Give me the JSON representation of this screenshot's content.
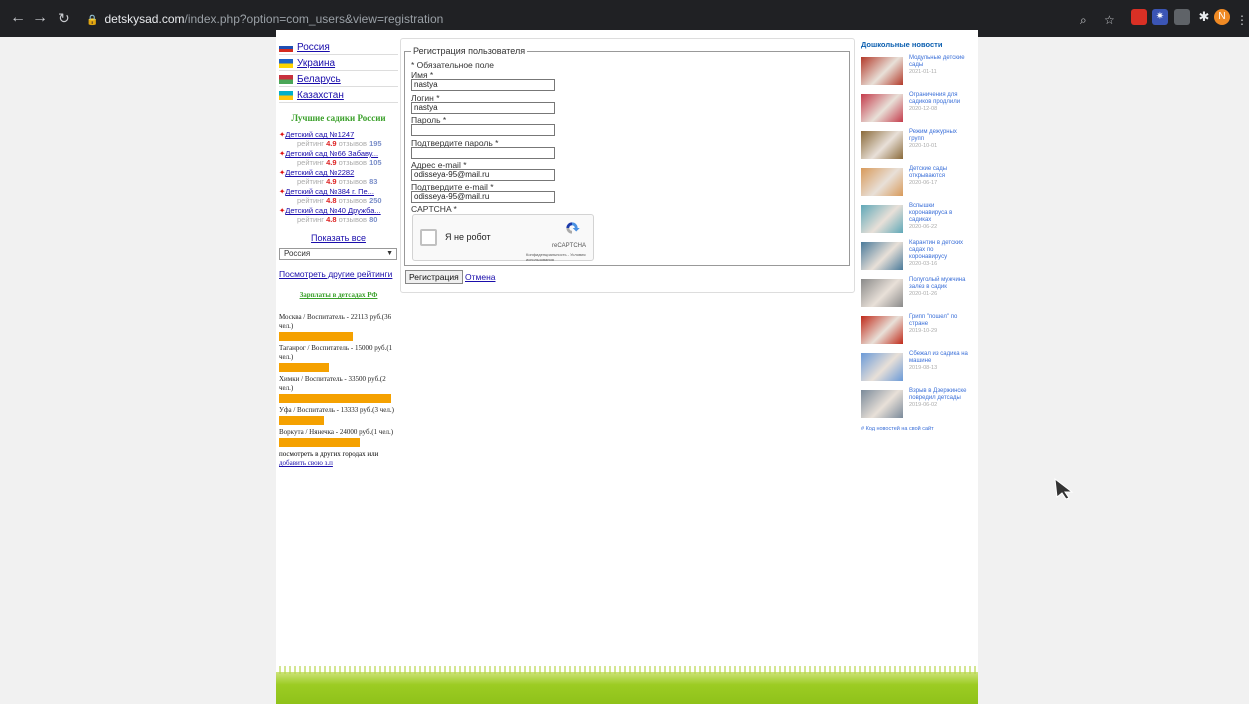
{
  "browser": {
    "url_host": "detskysad.com",
    "url_path": "/index.php?option=com_users&view=registration",
    "profile_initial": "N"
  },
  "left": {
    "countries": [
      {
        "label": "Россия",
        "colors": [
          "#ffffff",
          "#1f4fb4",
          "#d52b1e"
        ]
      },
      {
        "label": "Украина",
        "colors": [
          "#1f64c8",
          "#ffd500"
        ]
      },
      {
        "label": "Беларусь",
        "colors": [
          "#c8313e",
          "#4aa657"
        ]
      },
      {
        "label": "Казахстан",
        "colors": [
          "#00afca",
          "#fec50c"
        ]
      }
    ],
    "best_title": "Лучшие садики России",
    "kindergartens": [
      {
        "name": "Детский сад №1247",
        "rating_label": "рейтинг",
        "rating": "4.9",
        "reviews_label": "отзывов",
        "reviews": "195"
      },
      {
        "name": "Детский сад №66 Забаву...",
        "rating_label": "рейтинг",
        "rating": "4.9",
        "reviews_label": "отзывов",
        "reviews": "105"
      },
      {
        "name": "Детский сад №2282",
        "rating_label": "рейтинг",
        "rating": "4.9",
        "reviews_label": "отзывов",
        "reviews": "83"
      },
      {
        "name": "Детский сад №384 г. Пе...",
        "rating_label": "рейтинг",
        "rating": "4.8",
        "reviews_label": "отзывов",
        "reviews": "250"
      },
      {
        "name": "Детский сад №40 Дружба...",
        "rating_label": "рейтинг",
        "rating": "4.8",
        "reviews_label": "отзывов",
        "reviews": "80"
      }
    ],
    "show_all": "Показать все",
    "region_select": "Россия",
    "other_ratings": "Посмотреть другие рейтинги",
    "salary_title": "Зарплаты в детсадах РФ",
    "salaries": [
      {
        "text": "Москва / Воспитатель - 22113 руб.(36 чел.)",
        "fraction": 0.66
      },
      {
        "text": "Таганрог / Воспитатель - 15000 руб.(1 чел.)",
        "fraction": 0.45
      },
      {
        "text": "Химки / Воспитатель - 33500 руб.(2 чел.)",
        "fraction": 1.0
      },
      {
        "text": "Уфа / Воспитатель - 13333 руб.(3 чел.)",
        "fraction": 0.4
      },
      {
        "text": "Воркута / Нянечка - 24000 руб.(1 чел.)",
        "fraction": 0.72
      }
    ],
    "other_cities_text": "посмотреть в других городах или",
    "add_salary_link": "добавить свою з.п"
  },
  "form": {
    "legend": "Регистрация пользователя",
    "required_note": "* Обязательное поле",
    "fields": {
      "name_label": "Имя *",
      "name_value": "nastya",
      "login_label": "Логин *",
      "login_value": "nastya",
      "password_label": "Пароль *",
      "password_value": "",
      "password2_label": "Подтвердите пароль *",
      "password2_value": "",
      "email_label": "Адрес e-mail *",
      "email_value": "odisseya-95@mail.ru",
      "email2_label": "Подтвердите e-mail *",
      "email2_value": "odisseya-95@mail.ru",
      "captcha_label": "CAPTCHA *"
    },
    "recaptcha": {
      "checkbox_text": "Я не робот",
      "brand": "reCAPTCHA",
      "links": "Конфиденциальность - Условия использования"
    },
    "submit_label": "Регистрация",
    "cancel_label": "Отмена"
  },
  "news": {
    "title": "Дошкольные новости",
    "items": [
      {
        "text": "Модульные детские сады",
        "date": "2021-01-11",
        "color": "#b33a2a"
      },
      {
        "text": "Ограничения для садиков продлили",
        "date": "2020-12-08",
        "color": "#c43b4b"
      },
      {
        "text": "Режим дежурных групп",
        "date": "2020-10-01",
        "color": "#8a6a3a"
      },
      {
        "text": "Детские сады открываются",
        "date": "2020-06-17",
        "color": "#d89a5a"
      },
      {
        "text": "Вспышки коронавируса в садиках",
        "date": "2020-06-22",
        "color": "#5fa8b8"
      },
      {
        "text": "Карантин в детских садах по коронавирусу",
        "date": "2020-03-16",
        "color": "#4a7a9a"
      },
      {
        "text": "Полуголый мужчина залез в садик",
        "date": "2020-01-26",
        "color": "#8a8a8a"
      },
      {
        "text": "Грипп \"пошел\" по стране",
        "date": "2019-10-29",
        "color": "#c02a1a"
      },
      {
        "text": "Сбежал из садика на машине",
        "date": "2019-08-13",
        "color": "#6a9ad8"
      },
      {
        "text": "Взрыв в Дзержинске повредил детсады",
        "date": "2019-06-02",
        "color": "#7a8a9a"
      }
    ],
    "embed_link": "# Код новостей на свой сайт"
  }
}
